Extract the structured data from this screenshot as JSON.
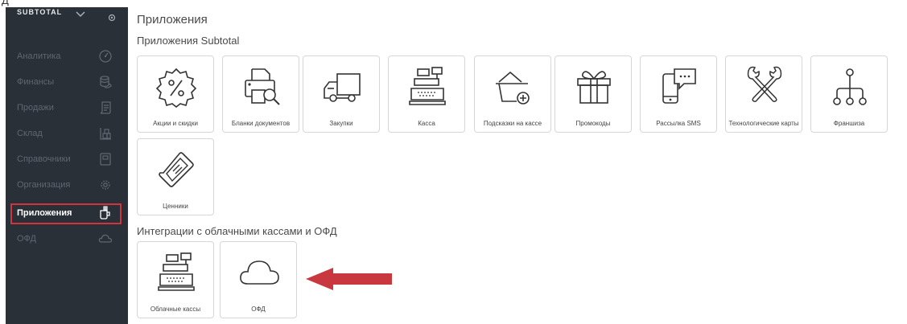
{
  "top_fragment": "Д",
  "sidebar": {
    "brand": "SUBTOTAL",
    "items": [
      {
        "label": "Аналитика",
        "icon": "gauge-icon"
      },
      {
        "label": "Финансы",
        "icon": "coins-icon"
      },
      {
        "label": "Продажи",
        "icon": "receipt-icon"
      },
      {
        "label": "Склад",
        "icon": "boxes-icon"
      },
      {
        "label": "Справочники",
        "icon": "book-icon"
      },
      {
        "label": "Организация",
        "icon": "gear-icon"
      },
      {
        "label": "Приложения",
        "icon": "apps-icon",
        "active": true
      },
      {
        "label": "ОФД",
        "icon": "cloud-icon"
      }
    ]
  },
  "main": {
    "title": "Приложения",
    "section_subtotal": "Приложения Subtotal",
    "apps": [
      {
        "label": "Акции и скидки",
        "icon": "discount-badge-icon"
      },
      {
        "label": "Бланки документов",
        "icon": "printer-search-icon"
      },
      {
        "label": "Закупки",
        "icon": "truck-icon"
      },
      {
        "label": "Касса",
        "icon": "cash-register-icon"
      },
      {
        "label": "Подсказки на кассе",
        "icon": "basket-plus-icon"
      },
      {
        "label": "Промокоды",
        "icon": "gift-icon"
      },
      {
        "label": "Рассылка SMS",
        "icon": "phone-message-icon"
      },
      {
        "label": "Технологические карты",
        "icon": "tools-icon"
      },
      {
        "label": "Франшиза",
        "icon": "hierarchy-icon"
      },
      {
        "label": "Ценники",
        "icon": "price-tag-icon"
      }
    ],
    "section_integrations": "Интеграции с облачными кассами и ОФД",
    "integrations": [
      {
        "label": "Облачные кассы",
        "icon": "cash-register-icon"
      },
      {
        "label": "ОФД",
        "icon": "cloud-icon"
      }
    ]
  },
  "colors": {
    "sidebar_bg": "#2a3038",
    "highlight": "#d0343c",
    "arrow": "#c9383f"
  }
}
